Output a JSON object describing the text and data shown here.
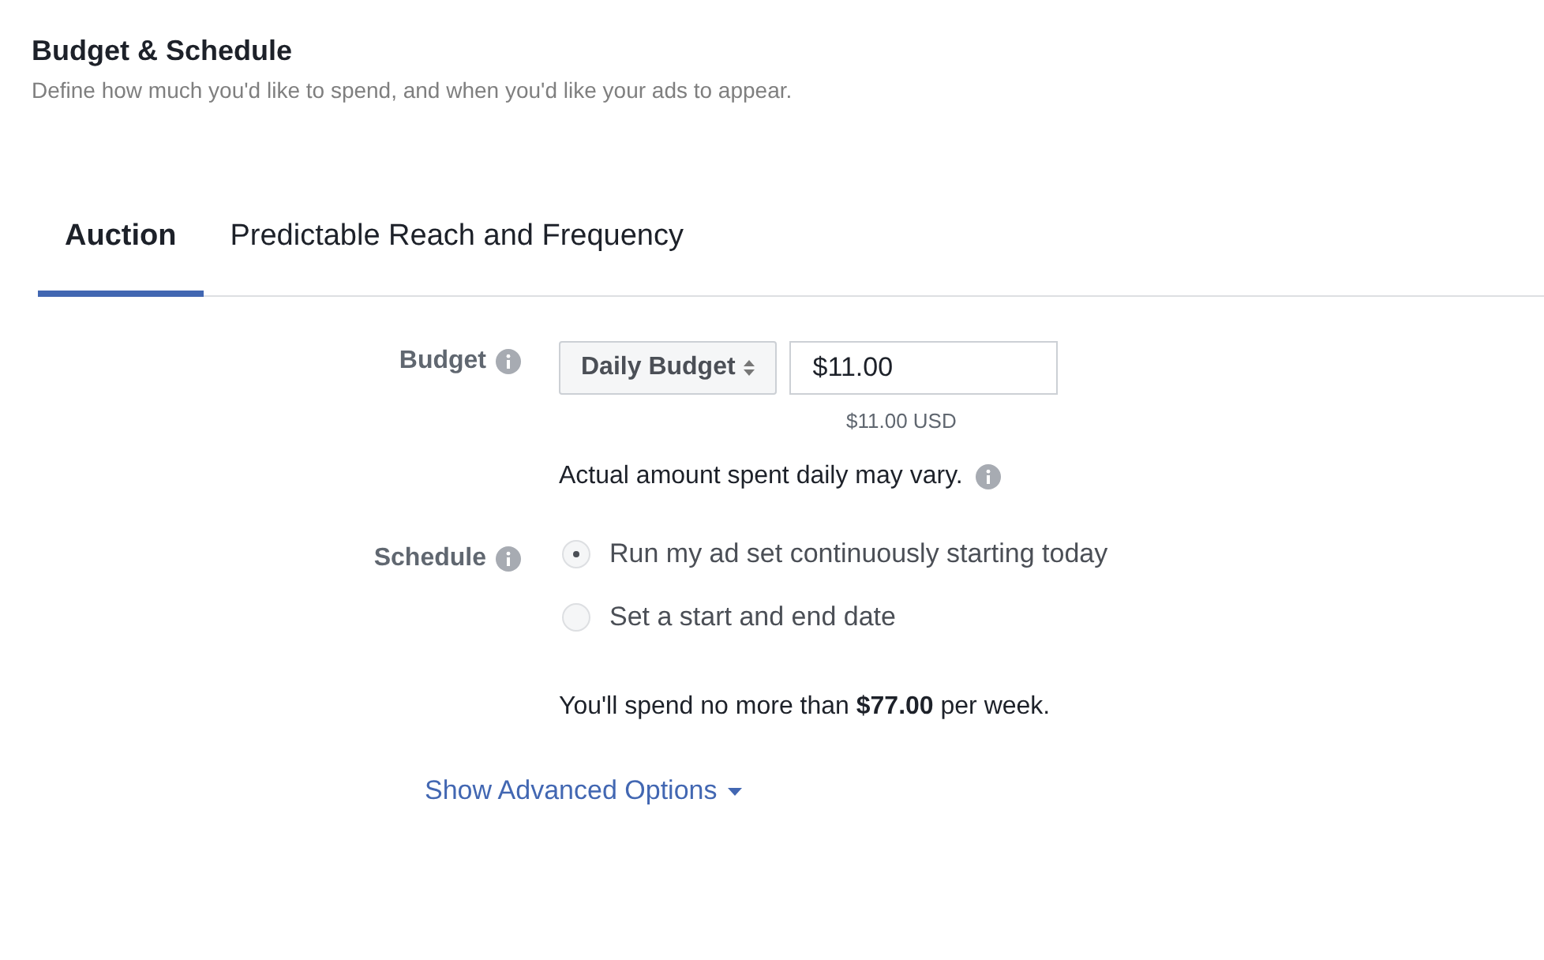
{
  "header": {
    "title": "Budget & Schedule",
    "subtitle": "Define how much you'd like to spend, and when you'd like your ads to appear."
  },
  "tabs": [
    {
      "label": "Auction",
      "selected": true
    },
    {
      "label": "Predictable Reach and Frequency",
      "selected": false
    }
  ],
  "budget": {
    "label": "Budget",
    "type_select": "Daily Budget",
    "amount": "$11.00",
    "converted": "$11.00 USD",
    "note": "Actual amount spent daily may vary."
  },
  "schedule": {
    "label": "Schedule",
    "options": [
      {
        "label": "Run my ad set continuously starting today",
        "selected": true
      },
      {
        "label": "Set a start and end date",
        "selected": false
      }
    ]
  },
  "summary": "You'll spend no more than **$77.00** per week.",
  "advanced_link": "Show Advanced Options"
}
